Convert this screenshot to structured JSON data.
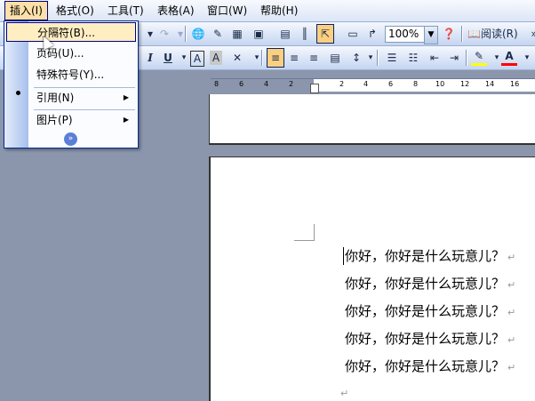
{
  "menubar": {
    "items": [
      {
        "label": "插入(I)"
      },
      {
        "label": "格式(O)"
      },
      {
        "label": "工具(T)"
      },
      {
        "label": "表格(A)"
      },
      {
        "label": "窗口(W)"
      },
      {
        "label": "帮助(H)"
      }
    ]
  },
  "toolbar": {
    "zoom": "100%",
    "read_label": "阅读(R)"
  },
  "formatting": {
    "italic": "I",
    "underline": "U",
    "char_border": "A",
    "char_shading": "A"
  },
  "ruler": {
    "ticks": [
      "8",
      "6",
      "4",
      "2",
      "2",
      "4",
      "6",
      "8",
      "10",
      "12",
      "14",
      "16"
    ]
  },
  "insert_menu": {
    "items": [
      {
        "label": "分隔符(B)..."
      },
      {
        "label": "页码(U)..."
      },
      {
        "label": "特殊符号(Y)..."
      },
      {
        "label": "引用(N)"
      },
      {
        "label": "图片(P)"
      }
    ]
  },
  "document": {
    "lines": [
      "你好，你好是什么玩意儿？",
      "你好，你好是什么玩意儿？",
      "你好，你好是什么玩意儿？",
      "你好，你好是什么玩意儿？",
      "你好，你好是什么玩意儿？"
    ],
    "para_mark": "↵"
  },
  "colors": {
    "highlight": "#ffff00",
    "font_color": "#ff0000"
  }
}
